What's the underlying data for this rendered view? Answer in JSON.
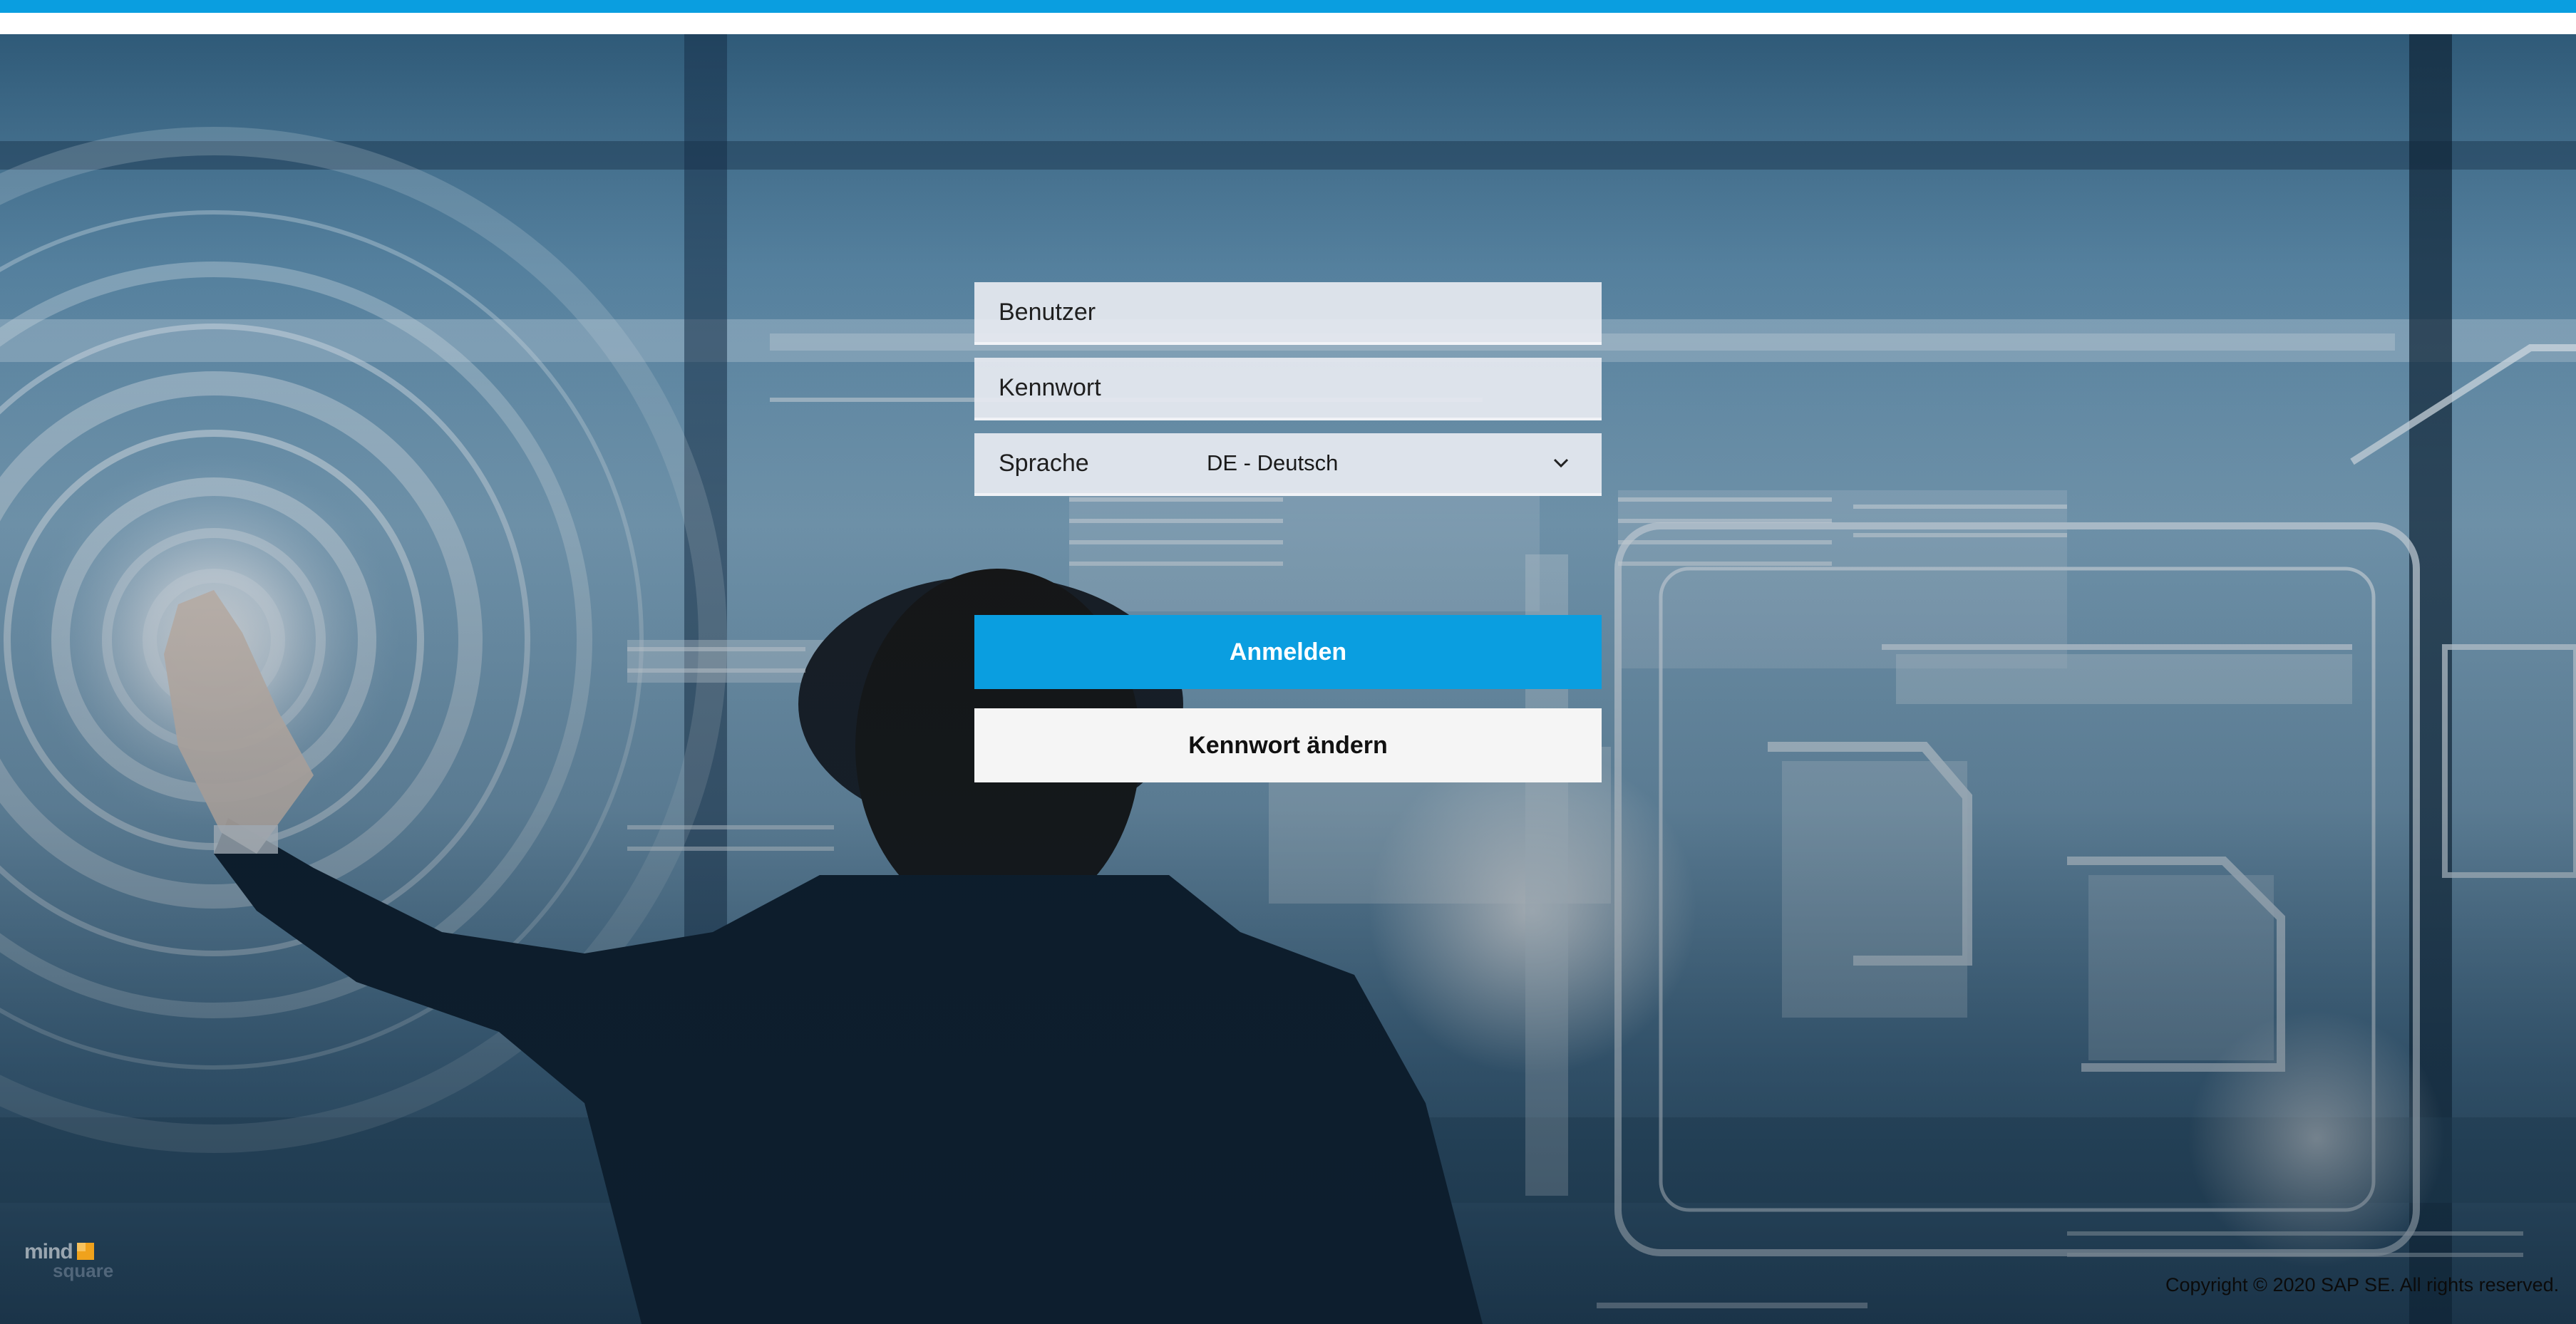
{
  "form": {
    "user_placeholder": "Benutzer",
    "password_placeholder": "Kennwort",
    "language_label": "Sprache",
    "language_value": "DE - Deutsch",
    "login_button": "Anmelden",
    "change_password_button": "Kennwort ändern"
  },
  "footer": {
    "logo_word_top": "mind",
    "logo_word_bottom": "square",
    "copyright": "Copyright © 2020 SAP SE. All rights reserved."
  },
  "colors": {
    "accent": "#0a9ee0",
    "secondary_button": "#f5f5f5",
    "logo_orange": "#f0a21c"
  },
  "icons": {
    "language_dropdown": "chevron-down-icon"
  }
}
